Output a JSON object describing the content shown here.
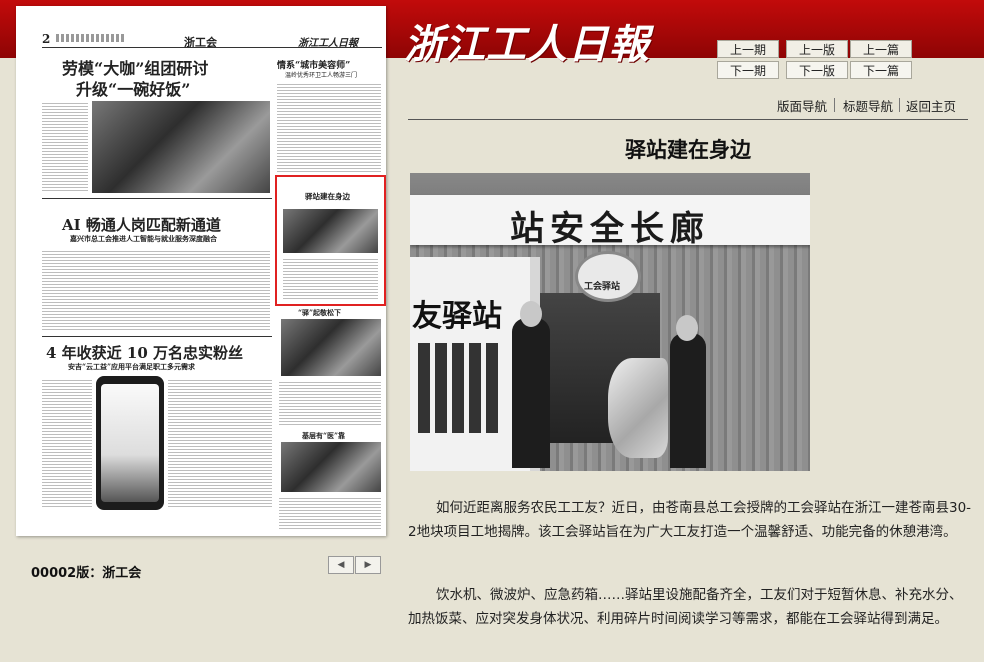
{
  "masthead": {
    "logo": "浙江工人日報"
  },
  "nav": {
    "prev_issue": "上一期",
    "prev_page": "上一版",
    "prev_article": "上一篇",
    "next_issue": "下一期",
    "next_page": "下一版",
    "next_article": "下一篇",
    "page_nav": "版面导航",
    "title_nav": "标题导航",
    "home": "返回主页"
  },
  "thumbnail": {
    "page_no": "2",
    "section": "浙工会",
    "headline1_l1": "劳模“大咖”组团研讨",
    "headline1_l2": "升级“一碗好饭”",
    "side_head": "情系“城市美容师”",
    "side_sub": "温岭优秀环卫工人畅游三门",
    "headline2": "AI 畅通人岗匹配新通道",
    "headline2_sub": "嘉兴市总工会推进人工智能与就业服务深度融合",
    "box_title": "驿站建在身边",
    "mid_head": "“驿”起敬松下",
    "headline3": "4 年收获近 10 万名忠实粉丝",
    "headline3_sub": "安吉“云工益”应用平台满足职工多元需求",
    "side_head3": "基层有“医”靠",
    "label": "00002版：浙工会"
  },
  "article": {
    "title": "驿站建在身边",
    "photo_banner": "站安全长廊",
    "photo_sign": "友驿站",
    "photo_badge": "工会驿站",
    "para1": "如何近距离服务农民工工友？近日，由苍南县总工会授牌的工会驿站在浙江一建苍南县30-2地块项目工地揭牌。该工会驿站旨在为广大工友打造一个温馨舒适、功能完备的休憩港湾。",
    "para2": "饮水机、微波炉、应急药箱……驿站里设施配备齐全，工友们对于短暂休息、补充水分、加热饭菜、应对突发身体状况、利用碎片时间阅读学习等需求，都能在工会驿站得到满足。"
  },
  "colors": {
    "masthead_red": "#c20b0b",
    "page_bg": "#e6e3d4",
    "highlight": "#e02121"
  }
}
